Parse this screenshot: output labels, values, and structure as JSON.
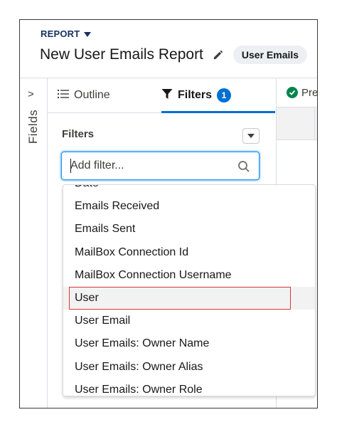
{
  "header": {
    "report_type": "REPORT",
    "title": "New User Emails Report",
    "badge": "User Emails"
  },
  "rail": {
    "chevron": ">",
    "label": "Fields"
  },
  "tabs": [
    {
      "label": "Outline",
      "icon": "list-icon"
    },
    {
      "label": "Filters",
      "icon": "filter-icon",
      "count": "1"
    }
  ],
  "preview": {
    "label": "Pre",
    "status_color": "#04844b"
  },
  "filters": {
    "heading": "Filters",
    "search_placeholder": "Add filter..."
  },
  "dropdown": {
    "options": [
      "Date",
      "Emails Received",
      "Emails Sent",
      "MailBox Connection Id",
      "MailBox Connection Username",
      "User",
      "User Email",
      "User Emails: Owner Name",
      "User Emails: Owner Alias",
      "User Emails: Owner Role"
    ],
    "highlighted_index": 5
  },
  "colors": {
    "brand_blue": "#0070d2",
    "title_navy": "#16325c",
    "highlight_red": "#d9363e"
  }
}
